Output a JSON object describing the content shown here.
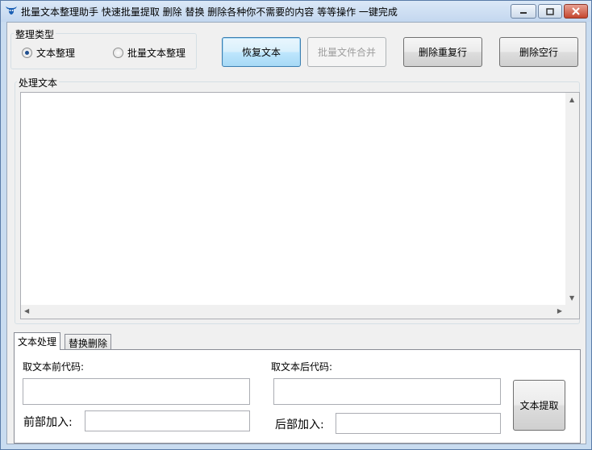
{
  "window": {
    "title": "批量文本整理助手   快速批量提取 删除  替换 删除各种你不需要的内容 等等操作 一键完成",
    "min_icon": "minimize-icon",
    "max_icon": "maximize-icon",
    "close_icon": "close-icon"
  },
  "type_group": {
    "label": "整理类型",
    "options": [
      {
        "label": "文本整理",
        "selected": true
      },
      {
        "label": "批量文本整理",
        "selected": false
      }
    ]
  },
  "toolbar": {
    "restore_label": "恢复文本",
    "merge_label": "批量文件合并",
    "dedupe_label": "删除重复行",
    "remove_empty_label": "删除空行"
  },
  "process_group": {
    "label": "处理文本",
    "text": ""
  },
  "tabs": [
    {
      "label": "文本处理",
      "active": true
    },
    {
      "label": "替换删除",
      "active": false
    }
  ],
  "extract_panel": {
    "prefix_label": "取文本前代码:",
    "suffix_label": "取文本后代码:",
    "front_add_label": "前部加入:",
    "back_add_label": "后部加入:",
    "extract_button": "文本提取",
    "prefix_value": "",
    "suffix_value": "",
    "front_add_value": "",
    "back_add_value": ""
  }
}
